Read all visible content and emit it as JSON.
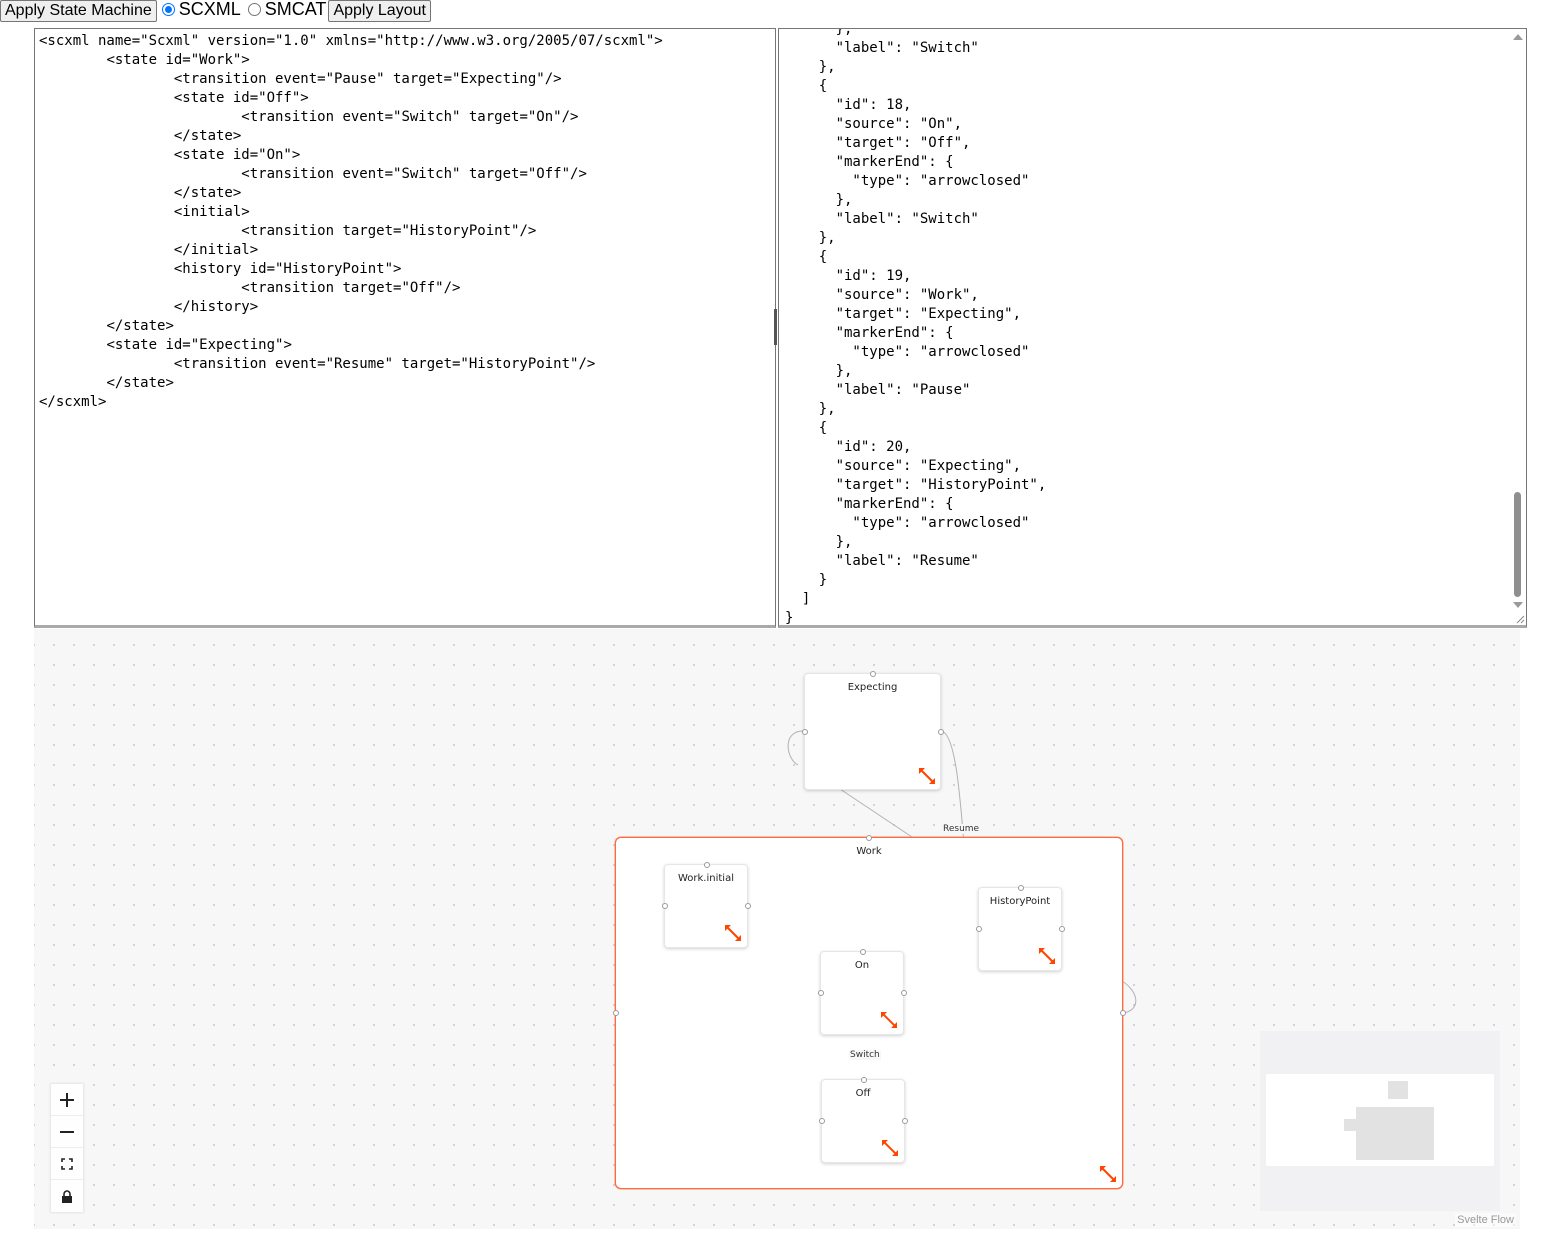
{
  "toolbar": {
    "apply_state_machine": "Apply State Machine",
    "scxml_label": "SCXML",
    "smcat_label": "SMCAT",
    "apply_layout": "Apply Layout",
    "selected_format": "SCXML"
  },
  "scxml_editor": {
    "text": "<scxml name=\"Scxml\" version=\"1.0\" xmlns=\"http://www.w3.org/2005/07/scxml\">\n\t<state id=\"Work\">\n\t\t<transition event=\"Pause\" target=\"Expecting\"/>\n\t\t<state id=\"Off\">\n\t\t\t<transition event=\"Switch\" target=\"On\"/>\n\t\t</state>\n\t\t<state id=\"On\">\n\t\t\t<transition event=\"Switch\" target=\"Off\"/>\n\t\t</state>\n\t\t<initial>\n\t\t\t<transition target=\"HistoryPoint\"/>\n\t\t</initial>\n\t\t<history id=\"HistoryPoint\">\n\t\t\t<transition target=\"Off\"/>\n\t\t</history>\n\t</state>\n\t<state id=\"Expecting\">\n\t\t<transition event=\"Resume\" target=\"HistoryPoint\"/>\n\t</state>\n</scxml>"
  },
  "json_editor": {
    "text": "      },\n      \"label\": \"Switch\"\n    },\n    {\n      \"id\": 18,\n      \"source\": \"On\",\n      \"target\": \"Off\",\n      \"markerEnd\": {\n        \"type\": \"arrowclosed\"\n      },\n      \"label\": \"Switch\"\n    },\n    {\n      \"id\": 19,\n      \"source\": \"Work\",\n      \"target\": \"Expecting\",\n      \"markerEnd\": {\n        \"type\": \"arrowclosed\"\n      },\n      \"label\": \"Pause\"\n    },\n    {\n      \"id\": 20,\n      \"source\": \"Expecting\",\n      \"target\": \"HistoryPoint\",\n      \"markerEnd\": {\n        \"type\": \"arrowclosed\"\n      },\n      \"label\": \"Resume\"\n    }\n  ]\n}"
  },
  "flow": {
    "nodes": {
      "expecting": "Expecting",
      "work": "Work",
      "work_initial": "Work.initial",
      "history_point": "HistoryPoint",
      "on": "On",
      "off": "Off"
    },
    "edge_labels": {
      "resume": "Resume",
      "switch": "Switch"
    },
    "attribution": "Svelte Flow"
  },
  "colors": {
    "group_border": "#ff6b3d",
    "resize_icon": "#ff4500",
    "edge": "#b1b1b7",
    "radio_checked": "#0075ff"
  }
}
